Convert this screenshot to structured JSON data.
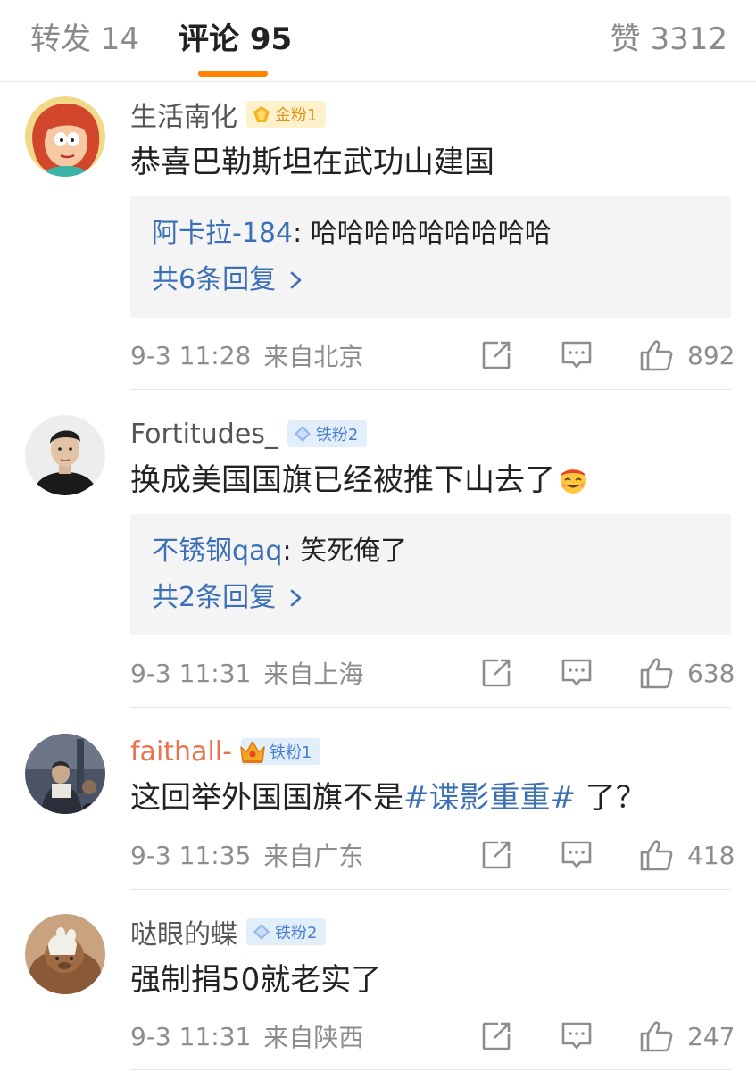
{
  "tabs": {
    "repost": "转发 14",
    "comment": "评论 95",
    "like": "赞 3312"
  },
  "colors": {
    "accent": "#ff8200",
    "link": "#3b6fb6",
    "orange_name": "#eb7350"
  },
  "comments": [
    {
      "username": "生活南化",
      "badge": "金粉1",
      "badge_type": "gold",
      "text": "恭喜巴勒斯坦在武功山建国",
      "reply": {
        "user": "阿卡拉-184",
        "colon": ": ",
        "content": "哈哈哈哈哈哈哈哈哈"
      },
      "more_replies": "共6条回复",
      "time": "9-3 11:28",
      "location": "来自北京",
      "likes": "892",
      "avatar": "cartoon-woman-avatar"
    },
    {
      "username": "Fortitudes_",
      "badge": "铁粉2",
      "badge_type": "iron",
      "text": "换成美国国旗已经被推下山去了",
      "emoji": "laughing-emoji",
      "reply": {
        "user": "不锈钢qaq",
        "colon": ": ",
        "content": "笑死俺了"
      },
      "more_replies": "共2条回复",
      "time": "9-3 11:31",
      "location": "来自上海",
      "likes": "638",
      "avatar": "man-portrait-avatar"
    },
    {
      "username": "faithall-",
      "badge": "铁粉1",
      "badge_type": "crown",
      "text_before": "这回举外国国旗不是",
      "topic": "#谍影重重#",
      "text_after": " 了？",
      "time": "9-3 11:35",
      "location": "来自广东",
      "likes": "418",
      "avatar": "movie-scene-avatar"
    },
    {
      "username": "哒眼的蝶",
      "badge": "铁粉2",
      "badge_type": "iron",
      "text": "强制捐50就老实了",
      "time": "9-3 11:31",
      "location": "来自陕西",
      "likes": "247",
      "avatar": "capybara-avatar"
    }
  ]
}
